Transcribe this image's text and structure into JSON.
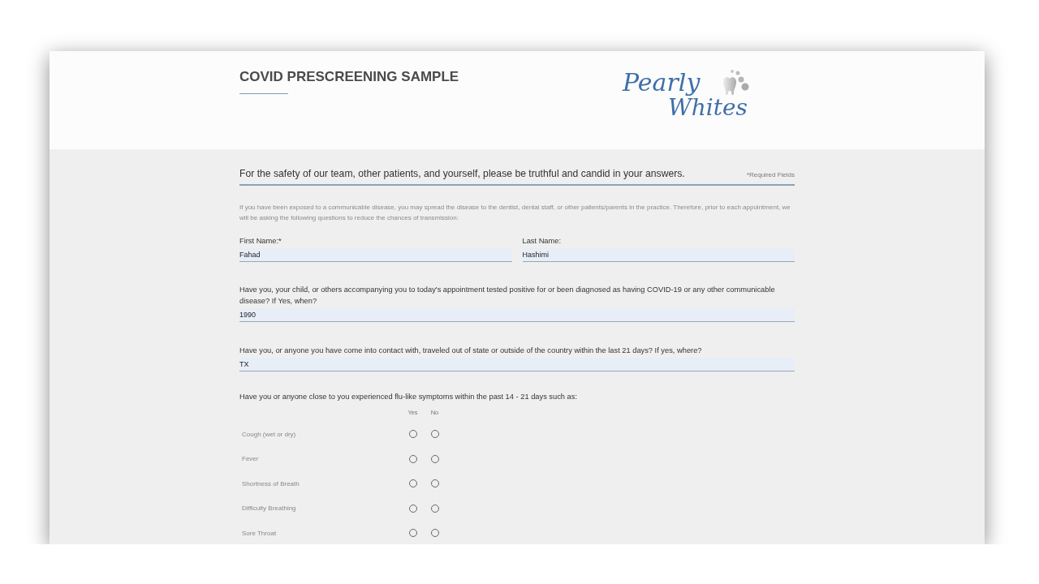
{
  "header": {
    "title": "COVID PRESCREENING SAMPLE",
    "logo": {
      "line_1": "Pearly",
      "line_2": "Whites"
    }
  },
  "intro": {
    "heading": "For the safety of our team, other patients, and yourself, please be truthful and candid in your answers.",
    "required_note": "*Required Fields",
    "paragraph": "If you have been exposed to a communicable disease, you may spread the disease to the dentist, dental staff, or other patients/parents in the practice. Therefore, prior to each appointment, we will be asking the following questions to reduce the chances of transmission:"
  },
  "name_fields": [
    {
      "label": "First Name:*",
      "value": "Fahad"
    },
    {
      "label": "Last Name:",
      "value": "Hashimi"
    }
  ],
  "questions": [
    {
      "label": "Have you, your child, or others accompanying you to today's appointment tested positive for or been diagnosed as having COVID-19 or any other communicable disease? If Yes, when?",
      "value": "1990"
    },
    {
      "label": "Have you, or anyone you have come into contact with, traveled out of state or outside of the country within the last 21 days? If yes, where?",
      "value": "TX"
    }
  ],
  "symptoms": {
    "question": "Have you or anyone close to you experienced flu-like symptoms within the past 14 - 21 days such as:",
    "columns": [
      "Yes",
      "No"
    ],
    "rows": [
      {
        "label": "Cough (wet or dry)",
        "yes": {
          "selected": false
        },
        "no": {
          "selected": false
        }
      },
      {
        "label": "Fever",
        "yes": {
          "selected": false
        },
        "no": {
          "selected": false
        }
      },
      {
        "label": "Shortness of Breath",
        "yes": {
          "selected": false
        },
        "no": {
          "selected": false
        }
      },
      {
        "label": "Difficulty Breathing",
        "yes": {
          "selected": false
        },
        "no": {
          "selected": false
        }
      },
      {
        "label": "Sore Throat",
        "yes": {
          "selected": false
        },
        "no": {
          "selected": false
        }
      }
    ]
  }
}
